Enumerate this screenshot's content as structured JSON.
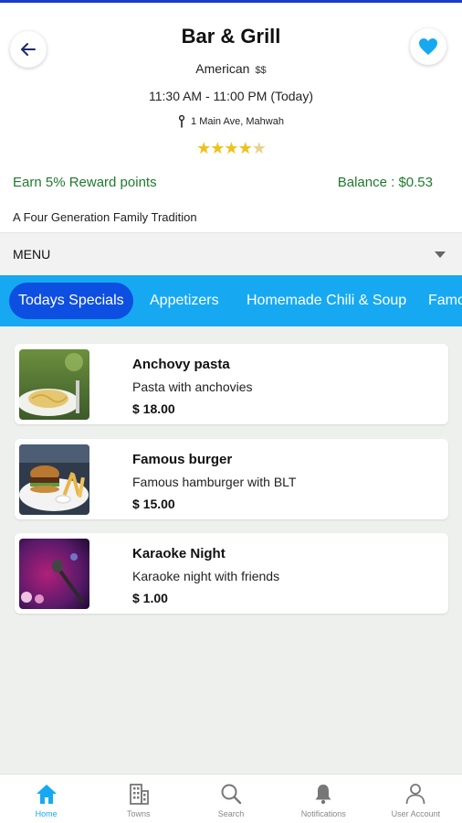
{
  "restaurant": {
    "name": "Bar & Grill",
    "cuisine": "American",
    "price_level": "$$",
    "hours": "11:30 AM - 11:00 PM (Today)",
    "address": "1 Main Ave, Mahwah",
    "rating": 4.5,
    "stars": "★★★★",
    "half_star": "★"
  },
  "rewards": {
    "earn_text": "Earn 5%  Reward points",
    "balance_text": "Balance : $0.53"
  },
  "tagline": "A Four Generation Family Tradition",
  "menu_select": {
    "label": "MENU"
  },
  "tabs": [
    {
      "label": "Todays Specials",
      "active": true
    },
    {
      "label": "Appetizers"
    },
    {
      "label": "Homemade Chili & Soup"
    },
    {
      "label": "Famo"
    }
  ],
  "items": [
    {
      "name": "Anchovy pasta",
      "description": "Pasta with anchovies",
      "price": "$ 18.00"
    },
    {
      "name": "Famous burger",
      "description": "Famous hamburger with BLT",
      "price": "$ 15.00"
    },
    {
      "name": "Karaoke Night",
      "description": "Karaoke night with friends",
      "price": "$ 1.00"
    }
  ],
  "bottom_nav": [
    {
      "label": "Home",
      "icon": "home-icon",
      "active": true
    },
    {
      "label": "Towns",
      "icon": "building-icon"
    },
    {
      "label": "Search",
      "icon": "search-icon"
    },
    {
      "label": "Notifications",
      "icon": "bell-icon"
    },
    {
      "label": "User Account",
      "icon": "user-icon"
    }
  ],
  "colors": {
    "accent": "#16a9f2",
    "active_tab": "#0d4fe0",
    "reward_green": "#1e7b2c",
    "star": "#f0c11a",
    "heart": "#16a9f2"
  }
}
